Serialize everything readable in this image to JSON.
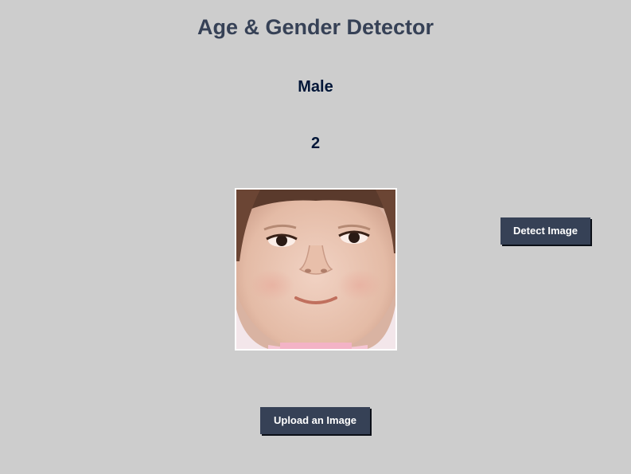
{
  "app": {
    "title": "Age & Gender Detector"
  },
  "result": {
    "gender": "Male",
    "age": "2"
  },
  "image": {
    "description_icon": "uploaded-face-photo"
  },
  "buttons": {
    "detect_label": "Detect Image",
    "upload_label": "Upload an Image"
  },
  "colors": {
    "background": "#cdcdcd",
    "title": "#364156",
    "result_text": "#011638",
    "button_bg": "#364156",
    "button_text": "#ffffff"
  }
}
